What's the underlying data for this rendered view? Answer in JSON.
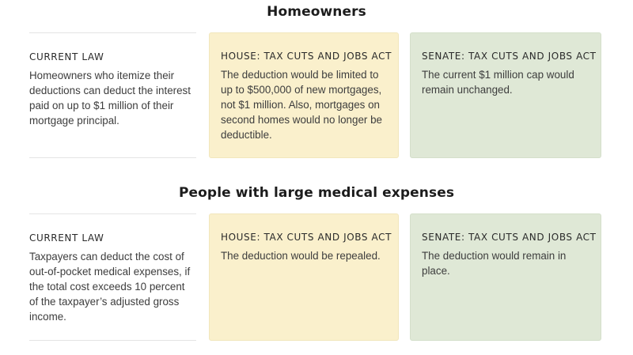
{
  "sections": [
    {
      "title": "Homeowners",
      "current_law": {
        "heading": "CURRENT LAW",
        "text": "Homeowners who itemize their deductions can deduct the interest paid on up to $1 million of their mortgage principal."
      },
      "house": {
        "heading": "HOUSE: TAX CUTS AND JOBS ACT",
        "text": "The deduction would be limited to up to $500,000 of new mortgages, not $1 million. Also, mortgages on second homes would no longer be deductible."
      },
      "senate": {
        "heading": "SENATE: TAX CUTS AND JOBS ACT",
        "text": "The current $1 million cap would remain unchanged."
      }
    },
    {
      "title": "People with large medical expenses",
      "current_law": {
        "heading": "CURRENT LAW",
        "text": "Taxpayers can deduct the cost of out-of-pocket medical expenses, if the total cost exceeds 10 percent of the taxpayer’s adjusted gross income."
      },
      "house": {
        "heading": "HOUSE: TAX CUTS AND JOBS ACT",
        "text": "The deduction would be repealed."
      },
      "senate": {
        "heading": "SENATE: TAX CUTS AND JOBS ACT",
        "text": "The deduction would remain in place."
      }
    }
  ],
  "colors": {
    "house_background": "#faf0cc",
    "senate_background": "#dfe8d6"
  }
}
